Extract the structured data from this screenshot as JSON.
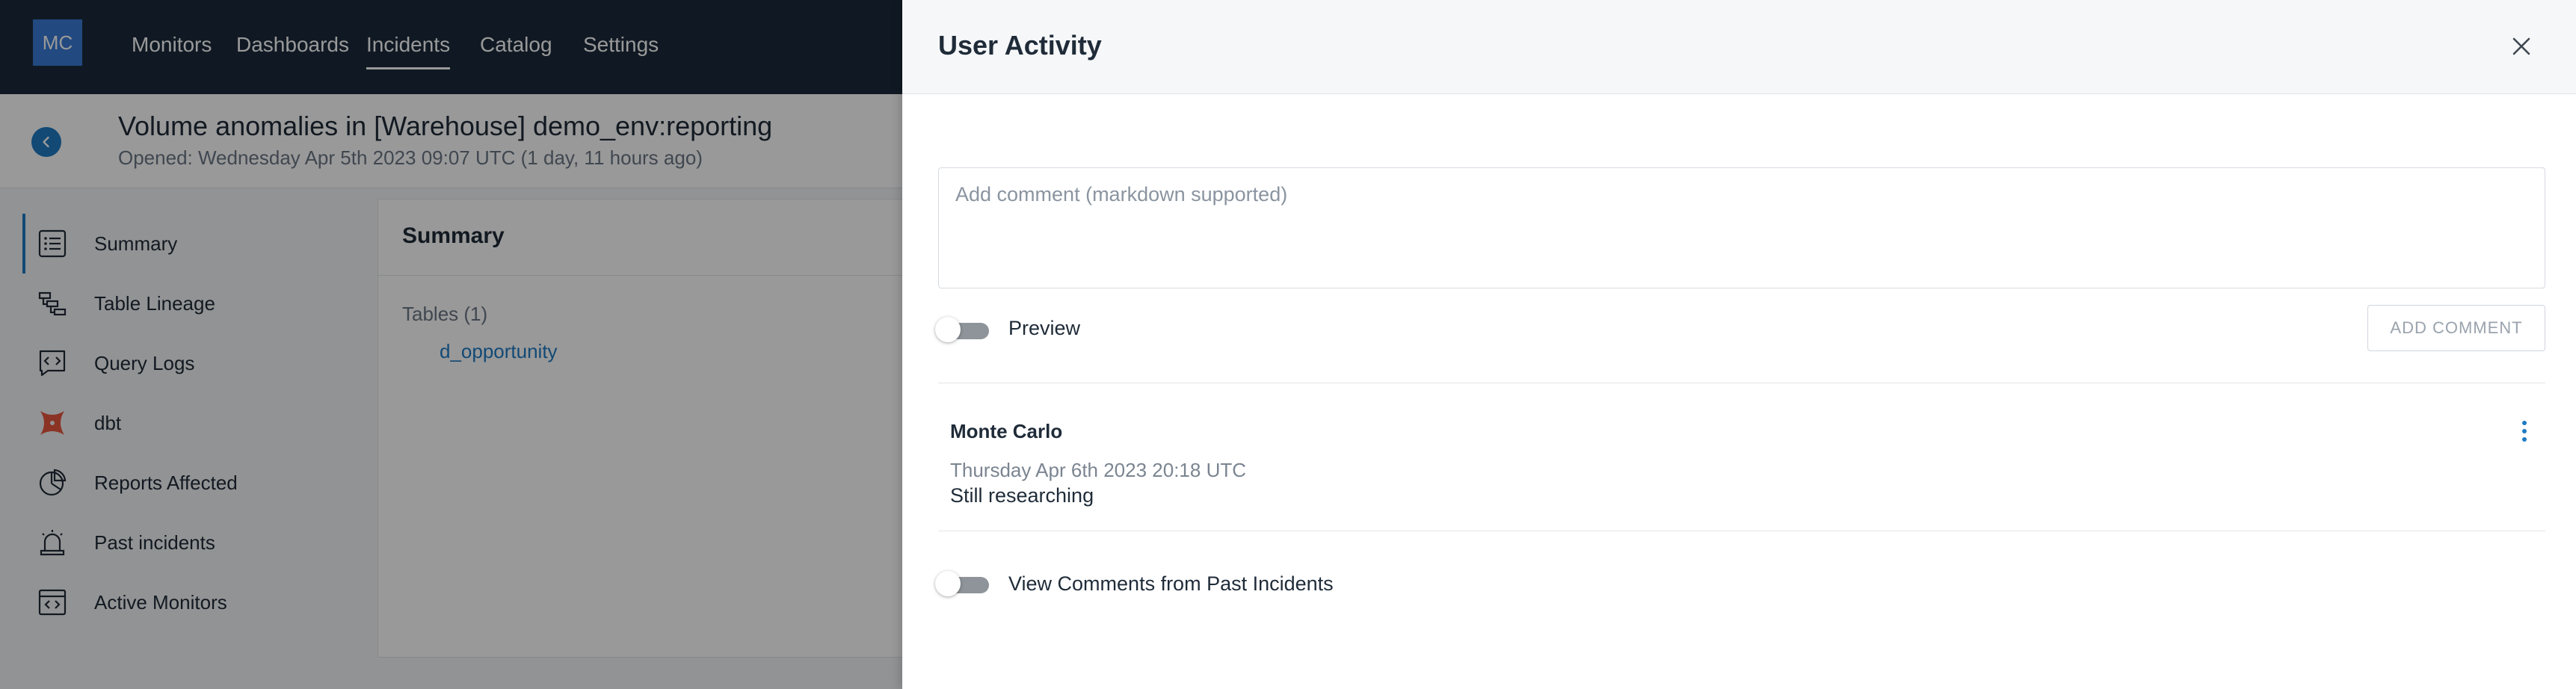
{
  "app": {
    "logo_text": "MC",
    "nav": [
      "Monitors",
      "Dashboards",
      "Incidents",
      "Catalog",
      "Settings"
    ],
    "active_nav": "Incidents"
  },
  "incident": {
    "title": "Volume anomalies in [Warehouse] demo_env:reporting",
    "opened": "Opened: Wednesday Apr 5th 2023 09:07 UTC (1 day, 11 hours ago)"
  },
  "sidebar": {
    "items": [
      {
        "label": "Summary",
        "icon": "list-icon"
      },
      {
        "label": "Table Lineage",
        "icon": "lineage-icon"
      },
      {
        "label": "Query Logs",
        "icon": "code-bubble-icon"
      },
      {
        "label": "dbt",
        "icon": "dbt-icon"
      },
      {
        "label": "Reports Affected",
        "icon": "pie-chart-icon"
      },
      {
        "label": "Past incidents",
        "icon": "alarm-icon"
      },
      {
        "label": "Active Monitors",
        "icon": "monitor-window-icon"
      }
    ]
  },
  "summary": {
    "title": "Summary",
    "tables_label": "Tables (1)",
    "table_link": "d_opportunity"
  },
  "drawer": {
    "title": "User Activity",
    "comment_placeholder": "Add comment (markdown supported)",
    "preview_label": "Preview",
    "add_comment_label": "ADD COMMENT",
    "comments": [
      {
        "author": "Monte Carlo",
        "timestamp": "Thursday Apr 6th 2023 20:18 UTC",
        "text": "Still researching"
      }
    ],
    "past_incidents_label": "View Comments from Past Incidents",
    "preview_enabled": false,
    "past_incidents_enabled": false
  },
  "colors": {
    "accent": "#1f7bc4",
    "nav_bg": "#1b2a3b",
    "logo_bg": "#3a7bd5",
    "dbt": "#e8573f"
  }
}
